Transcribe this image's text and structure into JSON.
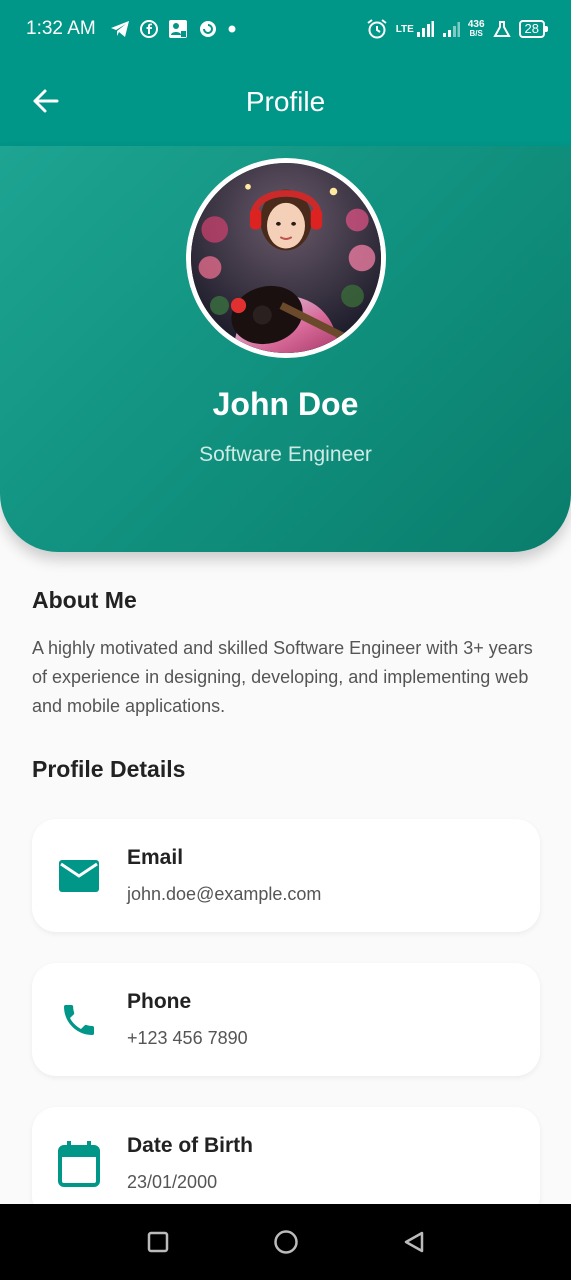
{
  "status_bar": {
    "time": "1:32 AM",
    "network_speed": "436",
    "network_unit": "B/S",
    "lte_label": "LTE",
    "battery": "28"
  },
  "app_bar": {
    "title": "Profile"
  },
  "profile": {
    "name": "John Doe",
    "role": "Software Engineer"
  },
  "about": {
    "title": "About Me",
    "text": "A highly motivated and skilled Software Engineer with 3+ years of experience in designing, developing, and implementing web and mobile applications."
  },
  "details": {
    "title": "Profile Details",
    "items": [
      {
        "label": "Email",
        "value": "john.doe@example.com",
        "icon": "email-icon"
      },
      {
        "label": "Phone",
        "value": "+123 456 7890",
        "icon": "phone-icon"
      },
      {
        "label": "Date of Birth",
        "value": "23/01/2000",
        "icon": "calendar-icon"
      }
    ]
  },
  "colors": {
    "primary": "#009688",
    "icon": "#009688",
    "background": "#fafafa"
  }
}
